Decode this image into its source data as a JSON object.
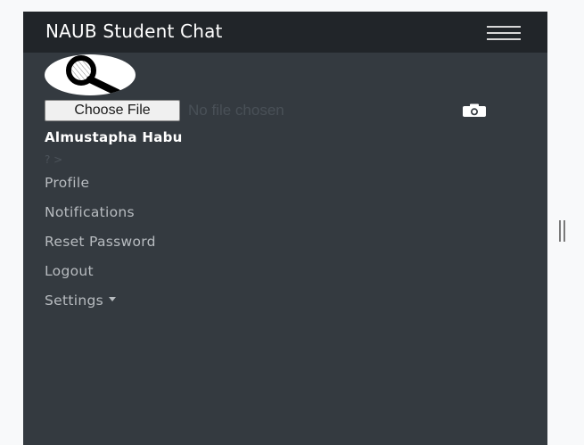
{
  "navbar": {
    "brand": "NAUB Student Chat",
    "toggler_icon": "hamburger-menu-icon"
  },
  "profile": {
    "avatar_icon": "magnifying-glass-icon",
    "file_input": {
      "button_label": "Choose File",
      "status_text": "No file chosen"
    },
    "camera_icon": "camera-icon",
    "username": "Almustapha Habu",
    "residue_text": "? >"
  },
  "menu": {
    "items": [
      {
        "label": "Profile"
      },
      {
        "label": "Notifications"
      },
      {
        "label": "Reset Password"
      },
      {
        "label": "Logout"
      },
      {
        "label": "Settings"
      }
    ]
  },
  "colors": {
    "panel": "#343a40",
    "navbar": "#212529",
    "menu_text": "#b8bcc0",
    "page_bg": "#f8f9fa"
  }
}
